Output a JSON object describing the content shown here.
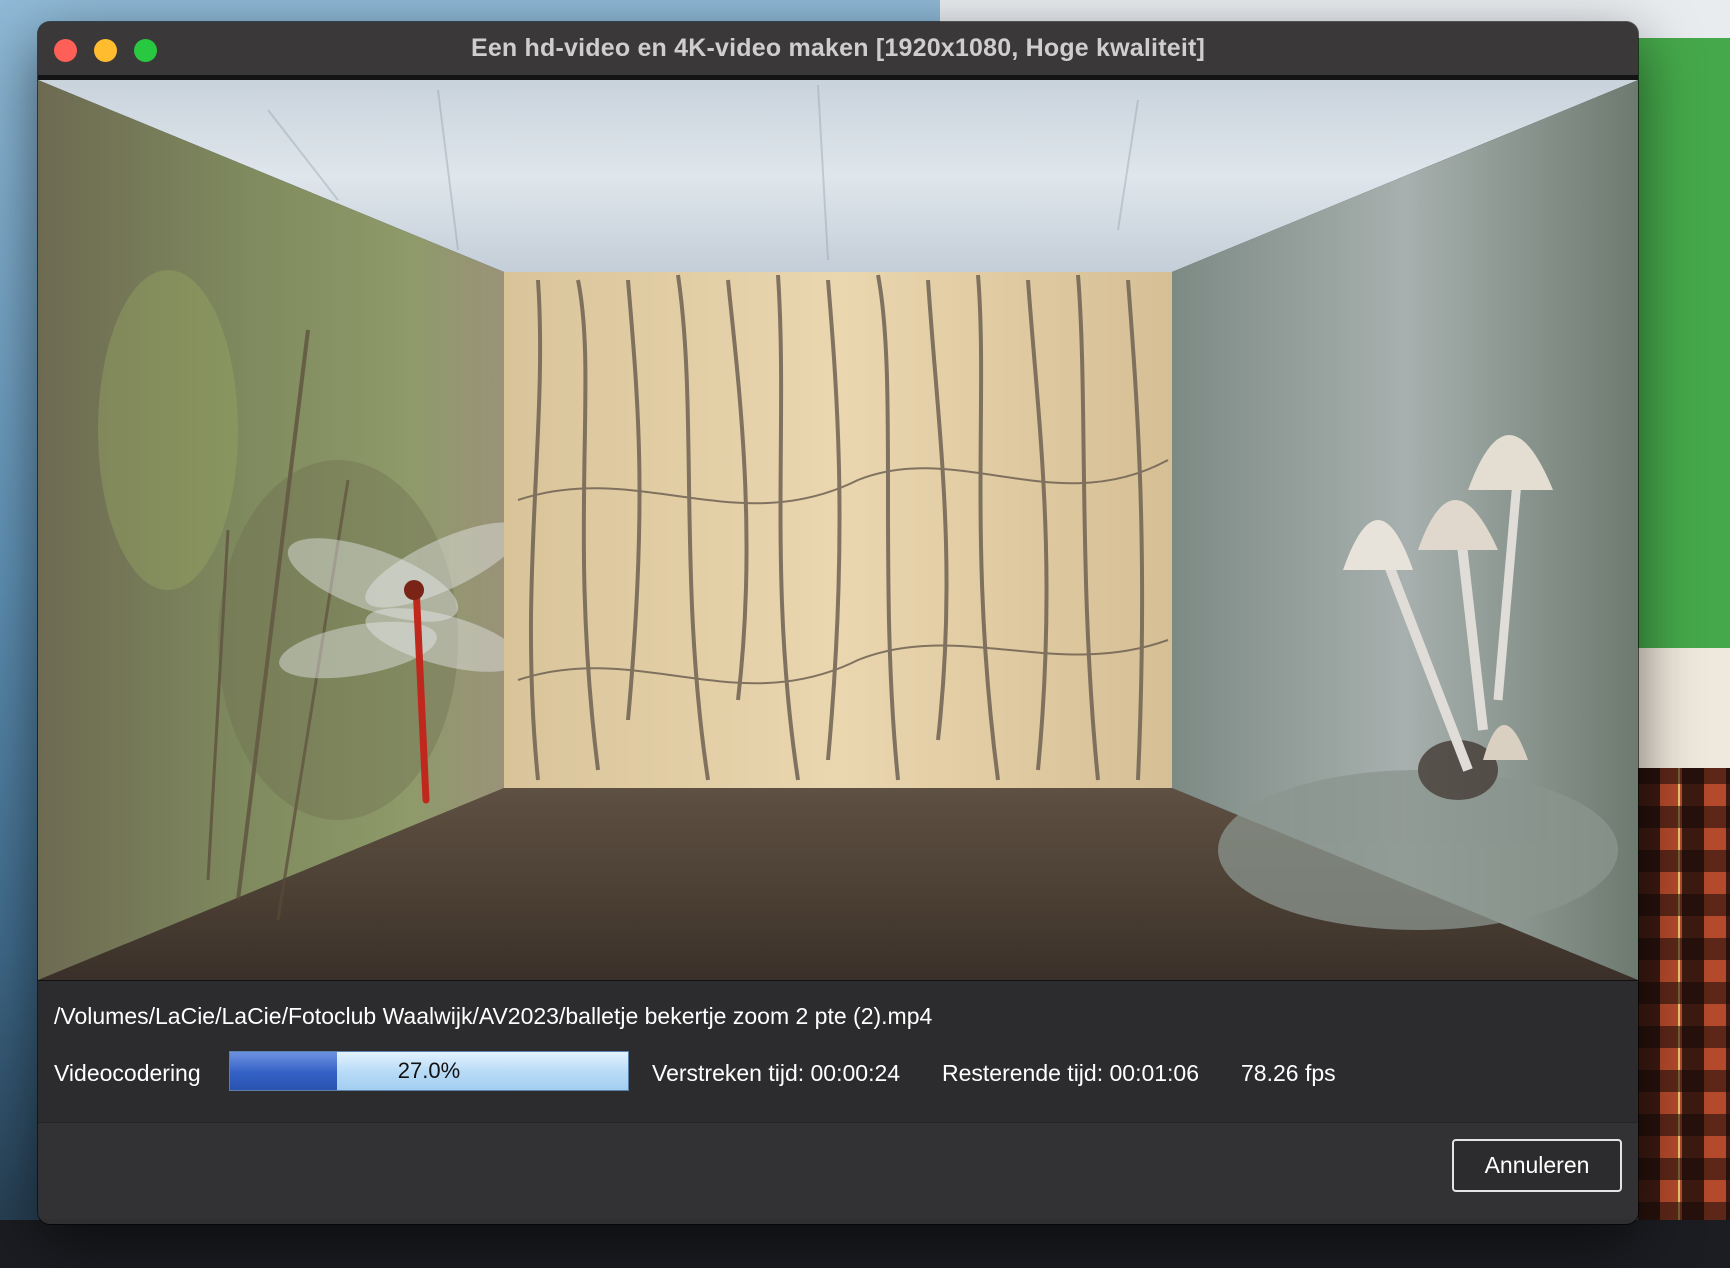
{
  "window": {
    "title": "Een hd-video en 4K-video maken [1920x1080, Hoge kwaliteit]"
  },
  "preview": {
    "description_icons": [
      "dragonfly-wall",
      "roots-wall",
      "mushroom-wall",
      "ceiling",
      "floor"
    ]
  },
  "status": {
    "file_path": "/Volumes/LaCie/LaCie/Fotoclub Waalwijk/AV2023/balletje bekertje zoom 2 pte (2).mp4",
    "stage_label": "Videocodering",
    "progress_text": "27.0%",
    "progress_fraction": 0.27,
    "elapsed": "Verstreken tijd: 00:00:24",
    "remaining": "Resterende tijd: 00:01:06",
    "fps": "78.26 fps"
  },
  "buttons": {
    "cancel_label": "Annuleren"
  },
  "colors": {
    "window_bg": "#2f2f31",
    "progress_fill": "#3461c6",
    "progress_track": "#b9dcf7"
  }
}
